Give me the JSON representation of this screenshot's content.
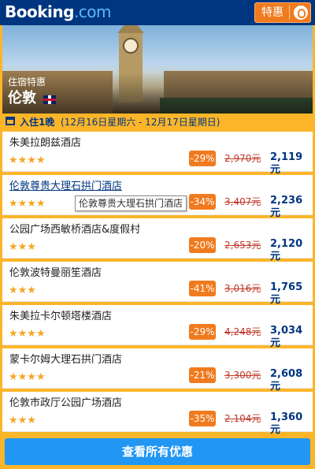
{
  "header": {
    "logo_main": "Booking",
    "logo_suffix": ".com",
    "deals_label": "特惠",
    "user_icon": "user-icon"
  },
  "hero": {
    "subtitle": "住宿特惠",
    "city": "伦敦",
    "flag_icon": "uk-flag-icon"
  },
  "checkin": {
    "icon": "calendar-icon",
    "label": "入住1晚",
    "dates": "(12月16日星期六 - 12月17日星期日)"
  },
  "hotels": [
    {
      "name": "朱美拉朗兹酒店",
      "stars": "★★★★",
      "discount": "-29%",
      "old_price": "2,970元",
      "price": "2,119元"
    },
    {
      "name": "伦敦尊贵大理石拱门酒店",
      "stars": "★★★★",
      "discount": "-34%",
      "old_price": "3,407元",
      "price": "2,236元"
    },
    {
      "name": "公园广场西敏桥酒店&度假村",
      "stars": "★★★",
      "discount": "-20%",
      "old_price": "2,653元",
      "price": "2,120元"
    },
    {
      "name": "伦敦波特曼丽笙酒店",
      "stars": "★★★",
      "discount": "-41%",
      "old_price": "3,016元",
      "price": "1,765元"
    },
    {
      "name": "朱美拉卡尔顿塔楼酒店",
      "stars": "★★★★",
      "discount": "-29%",
      "old_price": "4,248元",
      "price": "3,034元"
    },
    {
      "name": "蒙卡尔姆大理石拱门酒店",
      "stars": "★★★★",
      "discount": "-21%",
      "old_price": "3,300元",
      "price": "2,608元"
    },
    {
      "name": "伦敦市政厅公园广场酒店",
      "stars": "★★★",
      "discount": "-35%",
      "old_price": "2,104元",
      "price": "1,360元"
    }
  ],
  "tooltip": "伦敦尊贵大理石拱门酒店",
  "view_all_label": "查看所有优惠",
  "colors": {
    "brand_blue": "#003580",
    "accent_orange": "#f07b1f",
    "panel_yellow": "#fcb529",
    "button_blue": "#2196f3"
  }
}
